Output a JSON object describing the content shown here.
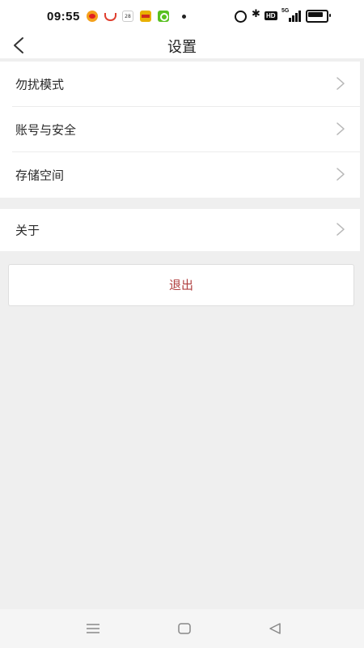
{
  "status_bar": {
    "time": "09:55",
    "calendar_day": "28",
    "network": "5G",
    "hd": "HD",
    "icons": [
      "weibo-icon",
      "mail-icon",
      "calendar-icon",
      "news-icon",
      "iqiyi-icon",
      "alarm-icon",
      "bluetooth-icon",
      "signal-icon",
      "battery-icon"
    ]
  },
  "header": {
    "title": "设置",
    "back_icon": "back-chevron-icon"
  },
  "settings": {
    "group1": [
      {
        "label": "勿扰模式"
      },
      {
        "label": "账号与安全"
      },
      {
        "label": "存储空间"
      }
    ],
    "group2": [
      {
        "label": "关于"
      }
    ]
  },
  "logout": {
    "label": "退出",
    "color": "#b04040"
  },
  "bottom_nav": {
    "icons": [
      "menu-icon",
      "home-icon",
      "back-triangle-icon"
    ]
  }
}
